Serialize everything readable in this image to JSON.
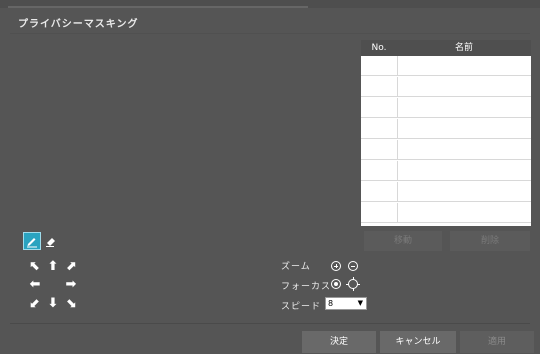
{
  "dialog": {
    "title": "プライバシーマスキング"
  },
  "mask_table": {
    "headers": {
      "no": "No.",
      "name": "名前"
    },
    "rows": [
      "",
      "",
      "",
      "",
      "",
      "",
      "",
      "",
      ""
    ],
    "move_label": "移動",
    "delete_label": "削除"
  },
  "tools": {
    "draw": "pencil-icon",
    "erase": "eraser-icon"
  },
  "ptz": {
    "zoom_label": "ズーム",
    "focus_label": "フォーカス",
    "speed_label": "スピード",
    "speed_value": "8"
  },
  "footer": {
    "ok_label": "決定",
    "cancel_label": "キャンセル",
    "apply_label": "適用"
  },
  "colors": {
    "background": "#555555",
    "accent": "#2aa3c0"
  }
}
